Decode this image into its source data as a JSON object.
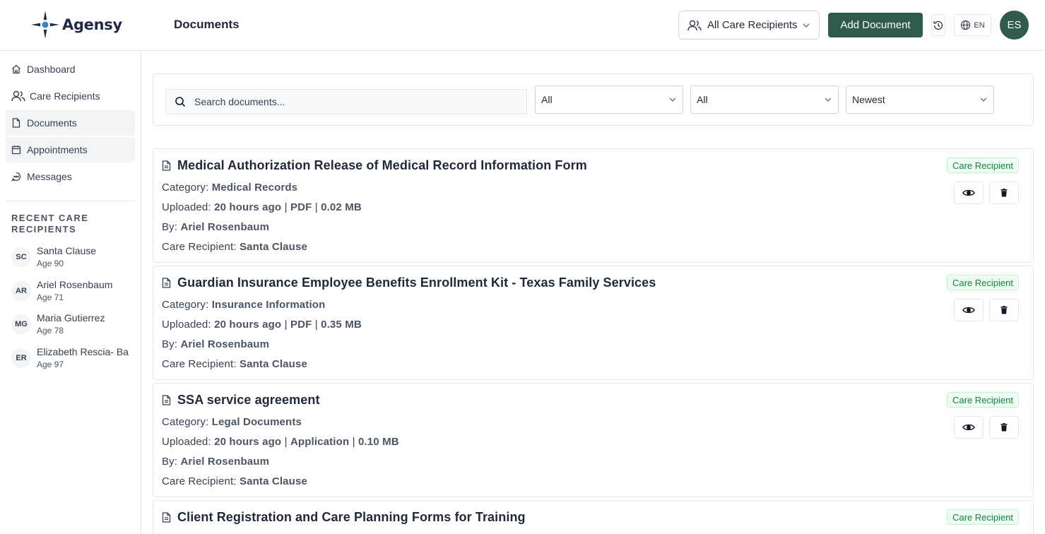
{
  "header": {
    "logo_text": "Agensy",
    "page_title": "Documents",
    "recipient_filter": "All Care Recipients",
    "add_document_label": "Add Document",
    "language": "EN",
    "user_initials": "ES"
  },
  "sidebar": {
    "items": [
      {
        "label": "Dashboard",
        "icon": "home-icon"
      },
      {
        "label": "Care Recipients",
        "icon": "users-icon"
      },
      {
        "label": "Documents",
        "icon": "file-icon"
      },
      {
        "label": "Appointments",
        "icon": "calendar-icon"
      },
      {
        "label": "Messages",
        "icon": "message-icon"
      }
    ],
    "recent_title": "RECENT CARE RECIPIENTS",
    "recent": [
      {
        "initials": "SC",
        "name": "Santa Clause",
        "age": "Age 90"
      },
      {
        "initials": "AR",
        "name": "Ariel Rosenbaum",
        "age": "Age 71"
      },
      {
        "initials": "MG",
        "name": "Maria Gutierrez",
        "age": "Age 78"
      },
      {
        "initials": "ER",
        "name": "Elizabeth Rescia- Ba",
        "age": "Age 97"
      }
    ]
  },
  "filters": {
    "search_placeholder": "Search documents...",
    "select1": "All",
    "select2": "All",
    "sort": "Newest"
  },
  "labels": {
    "category": "Category:",
    "uploaded": "Uploaded:",
    "by": "By:",
    "care_recipient": "Care Recipient:",
    "separator": "|"
  },
  "documents": [
    {
      "title": "Medical Authorization Release of Medical Record Information Form",
      "category": "Medical Records",
      "uploaded": "20 hours ago",
      "type": "PDF",
      "size": "0.02 MB",
      "by": "Ariel Rosenbaum",
      "recipient": "Santa Clause",
      "badge": "Care Recipient"
    },
    {
      "title": "Guardian Insurance Employee Benefits Enrollment Kit - Texas Family Services",
      "category": "Insurance Information",
      "uploaded": "20 hours ago",
      "type": "PDF",
      "size": "0.35 MB",
      "by": "Ariel Rosenbaum",
      "recipient": "Santa Clause",
      "badge": "Care Recipient"
    },
    {
      "title": "SSA service agreement",
      "category": "Legal Documents",
      "uploaded": "20 hours ago",
      "type": "Application",
      "size": "0.10 MB",
      "by": "Ariel Rosenbaum",
      "recipient": "Santa Clause",
      "badge": "Care Recipient"
    },
    {
      "title": "Client Registration and Care Planning Forms for Training",
      "badge": "Care Recipient"
    }
  ],
  "colors": {
    "primary": "#2f5a4d",
    "badge_text": "#15803d",
    "badge_bg": "#f0fdf4"
  }
}
